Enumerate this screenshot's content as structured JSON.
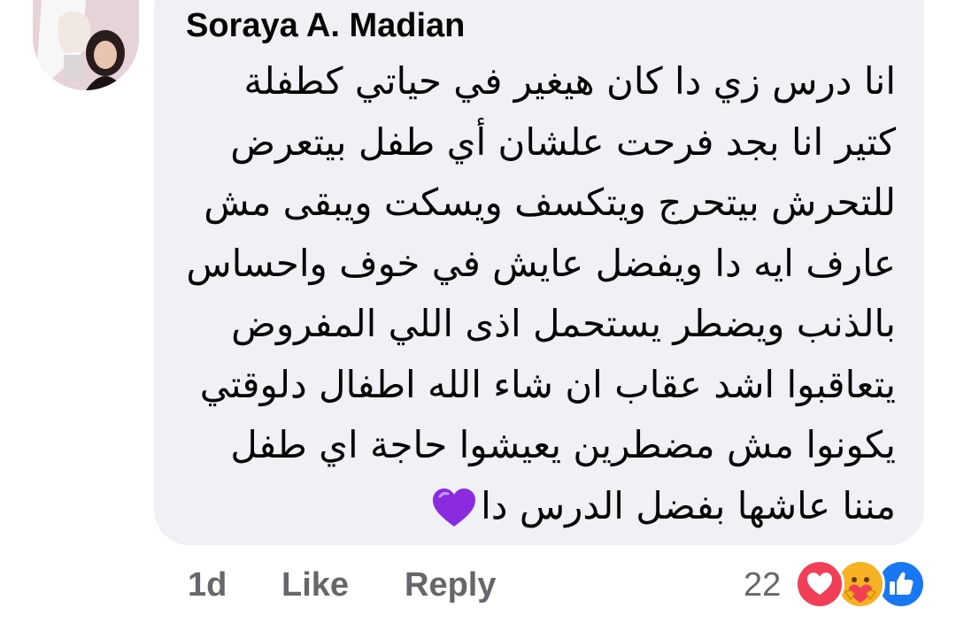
{
  "comment": {
    "author": "Soraya A. Madian",
    "lines": [
      "انا درس زي دا كان هيغير في حياتي كطفلة",
      "كتير انا بجد فرحت علشان أي طفل بيتعرض",
      "للتحرش بيتحرج ويتكسف ويسكت ويبقى مش",
      "عارف ايه دا ويفضل عايش في خوف واحساس",
      "بالذنب ويضطر يستحمل اذى اللي المفروض",
      "يتعاقبوا اشد عقاب ان شاء الله اطفال دلوقتي",
      "يكونوا مش مضطرين يعيشوا حاجة اي طفل",
      "مننا عاشها بفضل الدرس دا"
    ],
    "emoji": "purple-heart-icon"
  },
  "meta": {
    "time": "1d",
    "like_label": "Like",
    "reply_label": "Reply"
  },
  "reactions": {
    "count": "22",
    "types": [
      "love-reaction-icon",
      "care-reaction-icon",
      "like-reaction-icon"
    ]
  },
  "colors": {
    "bubble": "#eff1f4",
    "text": "#050505",
    "meta": "#65676b",
    "love": "#f33e58",
    "care": "#f7b125",
    "like": "#1877f2",
    "purple_heart": "#8a2be2"
  }
}
